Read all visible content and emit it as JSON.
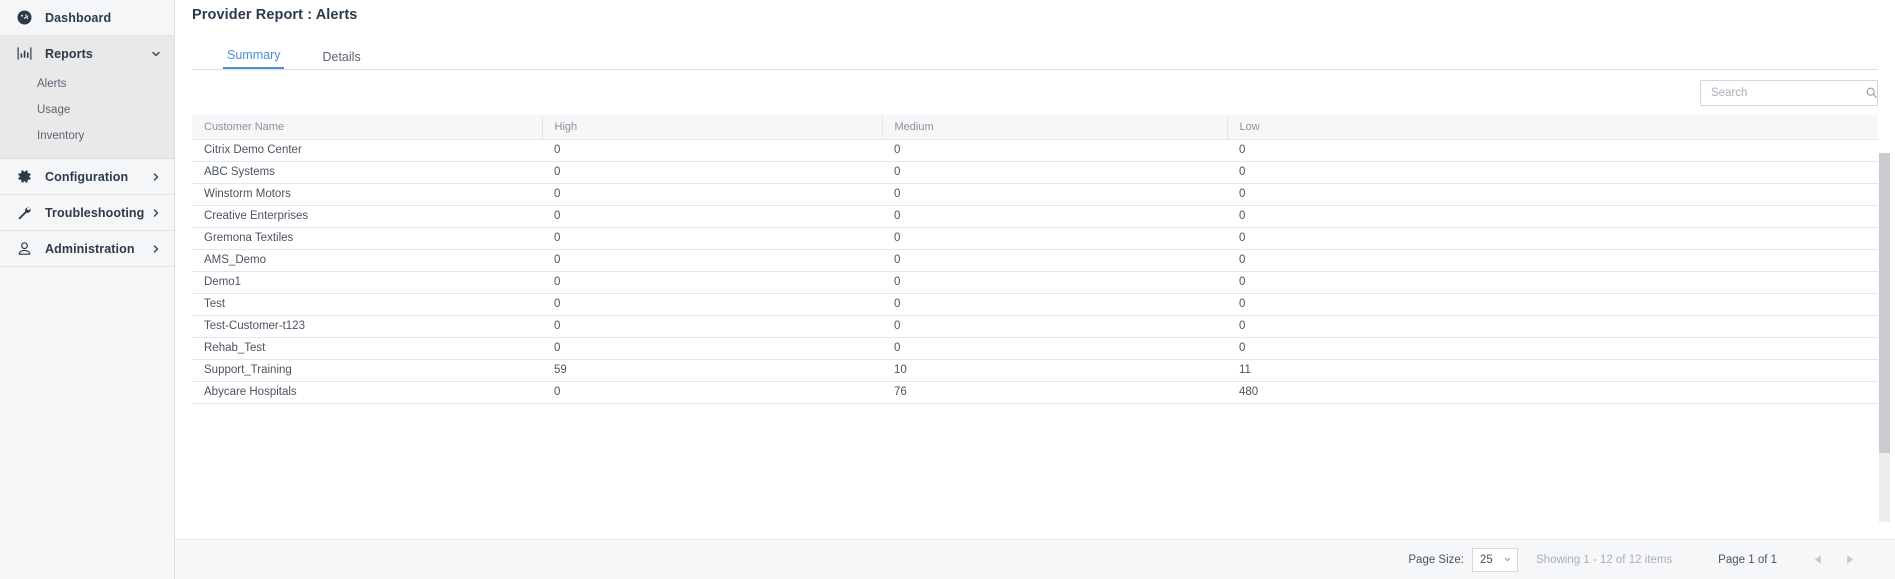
{
  "sidebar": {
    "groups": [
      {
        "id": "dashboard",
        "label": "Dashboard",
        "icon": "dashboard-gauge-icon",
        "expanded": false,
        "chevron": "none",
        "children": []
      },
      {
        "id": "reports",
        "label": "Reports",
        "icon": "bar-chart-icon",
        "expanded": true,
        "chevron": "down",
        "children": [
          {
            "id": "alerts",
            "label": "Alerts"
          },
          {
            "id": "usage",
            "label": "Usage"
          },
          {
            "id": "inventory",
            "label": "Inventory"
          }
        ]
      },
      {
        "id": "configuration",
        "label": "Configuration",
        "icon": "gear-icon",
        "expanded": false,
        "chevron": "right",
        "children": []
      },
      {
        "id": "troubleshooting",
        "label": "Troubleshooting",
        "icon": "wrench-icon",
        "expanded": false,
        "chevron": "right",
        "children": []
      },
      {
        "id": "administration",
        "label": "Administration",
        "icon": "user-icon",
        "expanded": false,
        "chevron": "right",
        "children": []
      }
    ]
  },
  "header": {
    "title": "Provider Report : Alerts"
  },
  "tabs": [
    {
      "id": "summary",
      "label": "Summary",
      "active": true
    },
    {
      "id": "details",
      "label": "Details",
      "active": false
    }
  ],
  "search": {
    "value": "",
    "placeholder": "Search",
    "icon": "search-icon"
  },
  "table": {
    "columns": [
      "Customer Name",
      "High",
      "Medium",
      "Low"
    ],
    "rows": [
      {
        "name": "Citrix Demo Center",
        "high": "0",
        "medium": "0",
        "low": "0"
      },
      {
        "name": "ABC Systems",
        "high": "0",
        "medium": "0",
        "low": "0"
      },
      {
        "name": "Winstorm Motors",
        "high": "0",
        "medium": "0",
        "low": "0"
      },
      {
        "name": "Creative Enterprises",
        "high": "0",
        "medium": "0",
        "low": "0"
      },
      {
        "name": "Gremona Textiles",
        "high": "0",
        "medium": "0",
        "low": "0"
      },
      {
        "name": "AMS_Demo",
        "high": "0",
        "medium": "0",
        "low": "0"
      },
      {
        "name": "Demo1",
        "high": "0",
        "medium": "0",
        "low": "0"
      },
      {
        "name": "Test",
        "high": "0",
        "medium": "0",
        "low": "0"
      },
      {
        "name": "Test-Customer-t123",
        "high": "0",
        "medium": "0",
        "low": "0"
      },
      {
        "name": "Rehab_Test",
        "high": "0",
        "medium": "0",
        "low": "0"
      },
      {
        "name": "Support_Training",
        "high": "59",
        "medium": "10",
        "low": "11"
      },
      {
        "name": "Abycare Hospitals",
        "high": "0",
        "medium": "76",
        "low": "480"
      }
    ]
  },
  "footer": {
    "page_size_label": "Page Size:",
    "page_size_value": "25",
    "showing": "Showing 1 - 12 of 12 items",
    "page_of": "Page 1 of 1",
    "prev_icon": "triangle-left-icon",
    "next_icon": "triangle-right-icon"
  },
  "colors": {
    "accent": "#4a90d9",
    "sidebar_bg": "#f4f6f8",
    "sidebar_expanded_bg": "#e9e9e9",
    "text_dark": "#2c3a4b",
    "text_muted": "#8a929c",
    "header_row_bg": "#f6f7f9",
    "border": "#e4e6e9"
  }
}
